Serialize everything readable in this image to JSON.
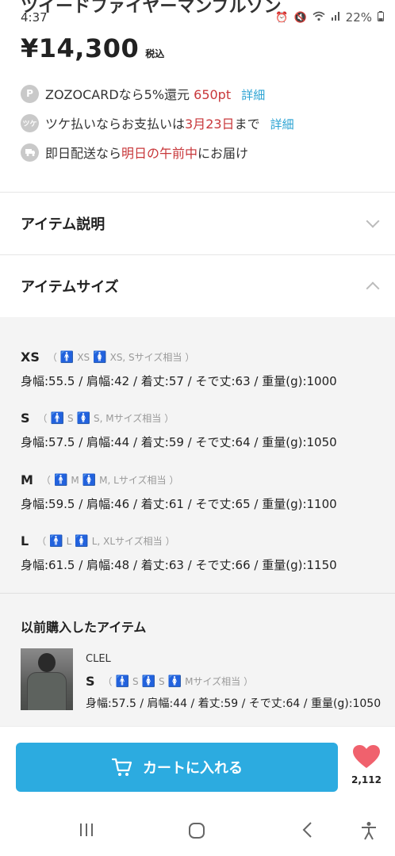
{
  "status_bar": {
    "partial_title": "ツイードファイヤーマンブルゾン",
    "time": "4:37",
    "battery": "22%",
    "icons": [
      "alarm-icon",
      "mute-icon",
      "wifi-icon",
      "signal-icon",
      "battery-icon"
    ]
  },
  "price": {
    "amount": "¥14,300",
    "tax": "税込"
  },
  "info": {
    "zozocard": {
      "icon": "P",
      "text": "ZOZOCARDなら5%還元 ",
      "points": "650pt",
      "link": "詳細"
    },
    "tsuke": {
      "icon": "ツケ",
      "pre": "ツケ払いならお支払いは",
      "date": "3月23日",
      "post": "まで",
      "link": "詳細"
    },
    "delivery": {
      "pre": "即日配送なら",
      "highlight": "明日の午前中",
      "post": "にお届け"
    }
  },
  "accordions": {
    "description": "アイテム説明",
    "size": "アイテムサイズ"
  },
  "sizes": [
    {
      "size": "XS",
      "men": "XS",
      "women": "XS, Sサイズ相当",
      "measurements": "身幅:55.5 / 肩幅:42 / 着丈:57 / そで丈:63 / 重量(g):1000"
    },
    {
      "size": "S",
      "men": "S",
      "women": "S, Mサイズ相当",
      "measurements": "身幅:57.5 / 肩幅:44 / 着丈:59 / そで丈:64 / 重量(g):1050"
    },
    {
      "size": "M",
      "men": "M",
      "women": "M, Lサイズ相当",
      "measurements": "身幅:59.5 / 肩幅:46 / 着丈:61 / そで丈:65 / 重量(g):1100"
    },
    {
      "size": "L",
      "men": "L",
      "women": "L, XLサイズ相当",
      "measurements": "身幅:61.5 / 肩幅:48 / 着丈:63 / そで丈:66 / 重量(g):1150"
    }
  ],
  "previous": {
    "title": "以前購入したアイテム",
    "brand": "CLEL",
    "size": "S",
    "men": "S",
    "women_a": "S",
    "women_b": "Mサイズ相当",
    "measurements": "身幅:57.5 / 肩幅:44 / 着丈:59 / そで丈:64 / 重量(g):1050"
  },
  "actions": {
    "cart": "カートに入れる",
    "favorite_count": "2,112",
    "cart_color": "#2cabe0",
    "heart_color": "#f0616d"
  },
  "colors": {
    "accent_red": "#c8373a",
    "link_blue": "#2ba3d3",
    "man_blue": "#2b6fc4",
    "woman_red": "#e25d5d"
  }
}
